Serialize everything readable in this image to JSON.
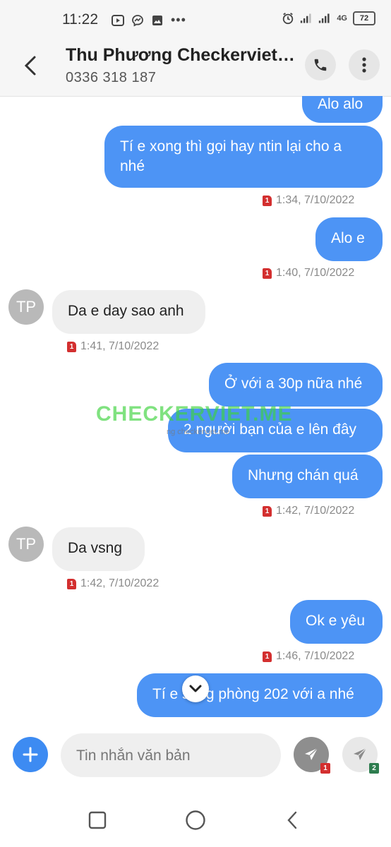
{
  "status_bar": {
    "time": "11:22",
    "battery": "72",
    "network": "4G"
  },
  "header": {
    "contact_name": "Thu Phương Checkerviet…",
    "contact_phone": "0336 318 187"
  },
  "messages": [
    {
      "dir": "out",
      "text": "Alo alo"
    },
    {
      "dir": "out",
      "text": "Tí e xong thì gọi hay ntin lại cho a nhé"
    },
    {
      "timestamp": "1:34, 7/10/2022",
      "sim": "1"
    },
    {
      "dir": "out",
      "text": "Alo e"
    },
    {
      "timestamp": "1:40, 7/10/2022",
      "sim": "1"
    },
    {
      "dir": "in",
      "avatar": "TP",
      "text": "Da e day sao anh"
    },
    {
      "timestamp": "1:41, 7/10/2022",
      "sim": "1"
    },
    {
      "dir": "out",
      "text": "Ở với a 30p nữa nhé"
    },
    {
      "dir": "out",
      "text": "2 người bạn của e lên đây"
    },
    {
      "dir": "out",
      "text": "Nhưng chán quá"
    },
    {
      "timestamp": "1:42, 7/10/2022",
      "sim": "1"
    },
    {
      "dir": "in",
      "avatar": "TP",
      "text": "Da vsng"
    },
    {
      "timestamp": "1:42, 7/10/2022",
      "sim": "1"
    },
    {
      "dir": "out",
      "text": "Ok e yêu"
    },
    {
      "timestamp": "1:46, 7/10/2022",
      "sim": "1"
    },
    {
      "dir": "out",
      "text": "Tí e sang phòng 202 với a nhé"
    }
  ],
  "watermark": {
    "text": "CHECKERVIET.ME",
    "sub": "ng checkerviet.me"
  },
  "composer": {
    "placeholder": "Tin nhắn văn bản",
    "sim1": "1",
    "sim2": "2"
  },
  "colors": {
    "bubble_out": "#4d94f5",
    "bubble_in": "#efefef",
    "accent": "#3d8bf2",
    "sim1": "#d32f2f",
    "sim2": "#2e7d4f"
  },
  "icons": [
    "back-arrow-icon",
    "phone-icon",
    "more-vert-icon",
    "chevron-down-icon",
    "plus-icon",
    "send-icon",
    "square-icon",
    "circle-icon",
    "back-triangle-icon"
  ]
}
